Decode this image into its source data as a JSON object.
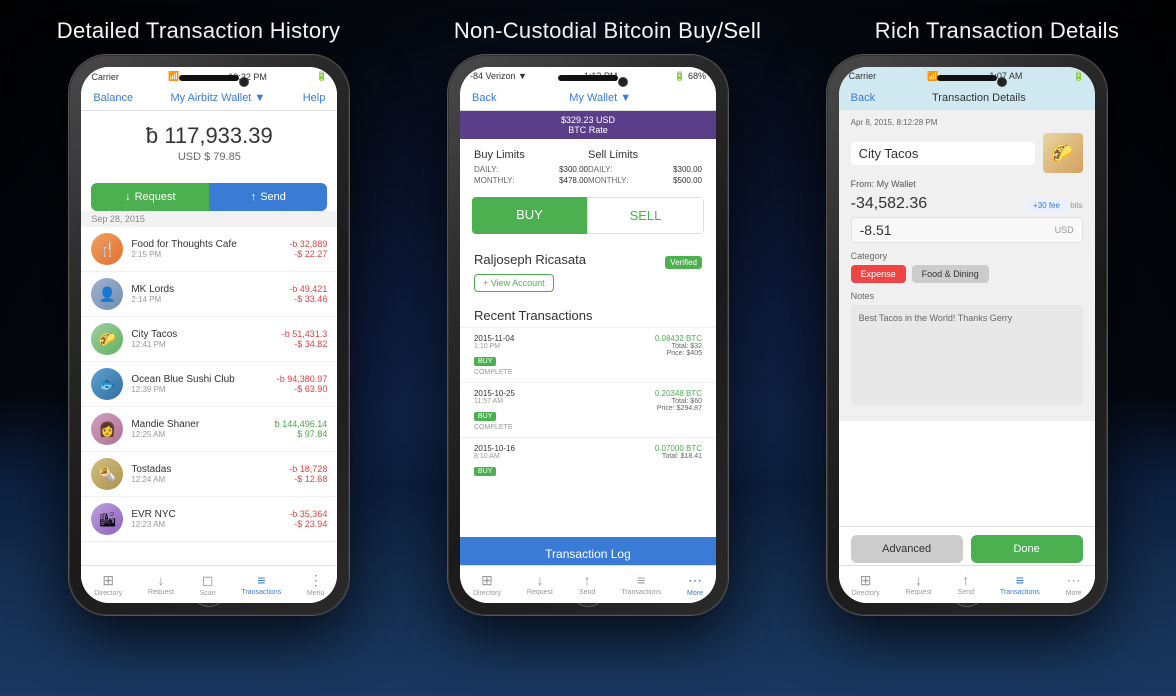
{
  "headings": {
    "title1": "Detailed Transaction History",
    "title2": "Non-Custodial Bitcoin Buy/Sell",
    "title3": "Rich Transaction Details"
  },
  "phone1": {
    "statusBar": {
      "carrier": "Carrier",
      "time": "10:32 PM",
      "battery": ""
    },
    "nav": {
      "balance": "Balance",
      "wallet": "My Airbitz Wallet ▼",
      "help": "Help"
    },
    "balance": {
      "btc": "ƀ 117,933.39",
      "usd": "USD $ 79.85"
    },
    "buttons": {
      "request": "Request",
      "send": "Send"
    },
    "dateHeader": "Sep 28, 2015",
    "transactions": [
      {
        "name": "Food for Thoughts Cafe",
        "time": "2:15 PM",
        "btc": "-b 32,889",
        "usd": "-$ 22.27",
        "icon": "🍴",
        "positive": false
      },
      {
        "name": "MK Lords",
        "time": "2:14 PM",
        "btc": "-b 49,421",
        "usd": "-$ 33.46",
        "icon": "👤",
        "positive": false
      },
      {
        "name": "City Tacos",
        "time": "12:41 PM",
        "btc": "-b 51,431.3",
        "usd": "-$ 34.82",
        "icon": "🌮",
        "positive": false
      },
      {
        "name": "Ocean Blue Sushi Club",
        "time": "12:39 PM",
        "btc": "-b 94,380.97",
        "usd": "-$ 63.90",
        "icon": "🐟",
        "positive": false
      },
      {
        "name": "Mandie Shaner",
        "time": "12:25 AM",
        "btc": "ƀ 144,496.14",
        "usd": "$ 97.84",
        "icon": "👩",
        "positive": true
      },
      {
        "name": "Tostadas",
        "time": "12:24 AM",
        "btc": "-b 18,728",
        "usd": "-$ 12.68",
        "icon": "🌯",
        "positive": false
      },
      {
        "name": "EVR NYC",
        "time": "12:23 AM",
        "btc": "-b 35,364",
        "usd": "-$ 23.94",
        "icon": "🏙",
        "positive": false
      }
    ],
    "bottomNav": [
      {
        "label": "Directory",
        "icon": "⊞",
        "active": false
      },
      {
        "label": "Request",
        "icon": "↓",
        "active": false
      },
      {
        "label": "Scan",
        "icon": "◻",
        "active": false
      },
      {
        "label": "Transactions",
        "icon": "≡",
        "active": true
      },
      {
        "label": "Menu",
        "icon": "⋮",
        "active": false
      }
    ]
  },
  "phone2": {
    "statusBar": {
      "carrier": "-84 Verizon ▼",
      "time": "1:13 PM",
      "battery": "68%"
    },
    "nav": {
      "back": "Back",
      "wallet": "My Wallet ▼"
    },
    "priceBar": "$329.23 USD\nBTC Rate",
    "limits": {
      "buyTitle": "Buy Limits",
      "sellTitle": "Sell Limits",
      "dailyLabel": "DAILY:",
      "monthlyLabel": "MONTHLY:",
      "buyDaily": "$300.00",
      "buyMonthly": "$478.00",
      "sellDaily": "$300.00",
      "sellMonthly": "$500.00"
    },
    "buyBtn": "BUY",
    "sellBtn": "SELL",
    "user": {
      "name": "Raljoseph Ricasata",
      "viewAccount": "+ View Account",
      "verified": "Verified"
    },
    "recentTitle": "Recent Transactions",
    "transactions": [
      {
        "date": "2015-11-04",
        "time": "1:10 PM",
        "type": "BUY",
        "status": "COMPLETE",
        "btc": "0.08432 BTC",
        "total": "Total: $32",
        "price": "Price: $405"
      },
      {
        "date": "2015-10-25",
        "time": "11:57 AM",
        "type": "BUY",
        "status": "COMPLETE",
        "btc": "0.20348 BTC",
        "total": "Total: $60",
        "price": "Price: $294.87"
      },
      {
        "date": "2015-10-16",
        "time": "8:10 AM",
        "type": "BUY",
        "status": "",
        "btc": "0.07000 BTC",
        "total": "Total: $18.41",
        "price": ""
      }
    ],
    "txLogBtn": "Transaction Log",
    "bottomNav": [
      {
        "label": "Directory",
        "icon": "⊞",
        "active": false
      },
      {
        "label": "Request",
        "icon": "↓",
        "active": false
      },
      {
        "label": "Send",
        "icon": "↑",
        "active": false
      },
      {
        "label": "Transactions",
        "icon": "≡",
        "active": false
      },
      {
        "label": "More",
        "icon": "⋯",
        "active": true
      }
    ]
  },
  "phone3": {
    "statusBar": {
      "carrier": "Carrier",
      "time": "1:07 AM",
      "battery": ""
    },
    "nav": {
      "back": "Back",
      "title": "Transaction Details"
    },
    "details": {
      "timestamp": "Apr 8, 2015, 8:12:28 PM",
      "merchant": "City Tacos",
      "from": "From: My Wallet",
      "btcAmount": "-34,582.36",
      "fee": "+30 fee",
      "feeSuffix": "bits",
      "usdAmount": "-8.51",
      "usdLabel": "USD"
    },
    "categoryLabel": "Category",
    "categories": {
      "expense": "Expense",
      "foodDining": "Food & Dining"
    },
    "notesLabel": "Notes",
    "notesText": "Best Tacos in the World!  Thanks Gerry",
    "actions": {
      "advanced": "Advanced",
      "done": "Done"
    },
    "bottomNav": [
      {
        "label": "Directory",
        "icon": "⊞",
        "active": false
      },
      {
        "label": "Request",
        "icon": "↓",
        "active": false
      },
      {
        "label": "Send",
        "icon": "↑",
        "active": false
      },
      {
        "label": "Transactions",
        "icon": "≡",
        "active": true
      },
      {
        "label": "More",
        "icon": "⋯",
        "active": false
      }
    ]
  }
}
